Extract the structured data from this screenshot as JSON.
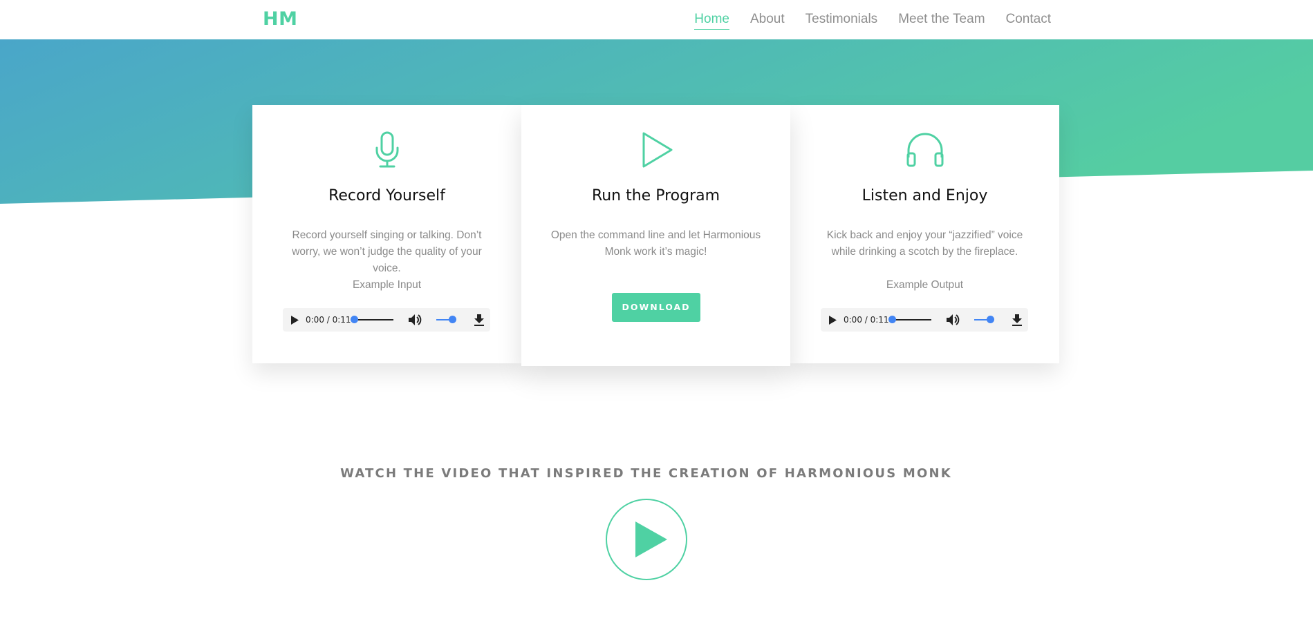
{
  "header": {
    "brand": "HM",
    "nav": [
      "Home",
      "About",
      "Testimonials",
      "Meet the Team",
      "Contact"
    ],
    "active": "Home"
  },
  "colors": {
    "accent": "#4fd1a3",
    "gradient_start": "#4aa6c9",
    "gradient_end": "#55cda2",
    "audio_blue": "#4285f4"
  },
  "cards": [
    {
      "icon": "microphone-icon",
      "title": "Record Yourself",
      "description": "Record yourself singing or talking. Don’t worry, we won’t judge the quality of your voice.",
      "example_label": "Example Input",
      "audio_time": "0:00 / 0:11"
    },
    {
      "icon": "play-triangle-icon",
      "title": "Run the Program",
      "description": "Open the command line and let Harmonious Monk work it’s magic!",
      "button_label": "DOWNLOAD"
    },
    {
      "icon": "headphones-icon",
      "title": "Listen and Enjoy",
      "description": "Kick back and enjoy your “jazzified” voice while drinking a scotch by the fireplace.",
      "example_label": "Example Output",
      "audio_time": "0:00 / 0:11"
    }
  ],
  "video": {
    "heading": "WATCH THE VIDEO THAT INSPIRED THE CREATION OF HARMONIOUS MONK",
    "icon": "play-circle-icon"
  }
}
